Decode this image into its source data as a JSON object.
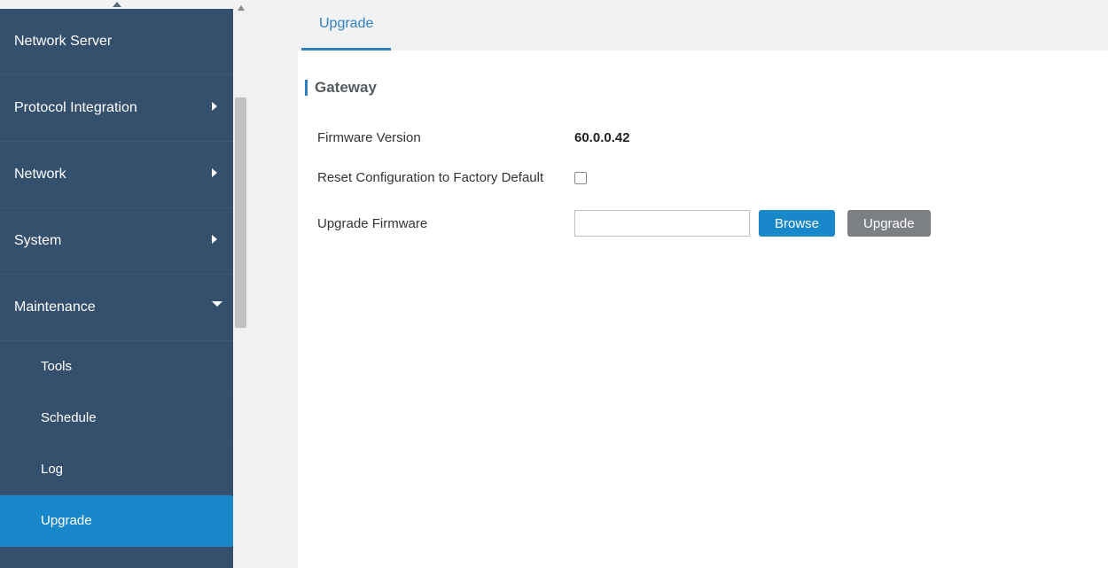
{
  "sidebar": {
    "items": [
      {
        "label": "Network Server",
        "hasChildren": false
      },
      {
        "label": "Protocol Integration",
        "hasChildren": true
      },
      {
        "label": "Network",
        "hasChildren": true
      },
      {
        "label": "System",
        "hasChildren": true
      },
      {
        "label": "Maintenance",
        "hasChildren": true,
        "expanded": true
      }
    ],
    "subitems": [
      {
        "label": "Tools"
      },
      {
        "label": "Schedule"
      },
      {
        "label": "Log"
      },
      {
        "label": "Upgrade"
      }
    ]
  },
  "tabs": {
    "active": "Upgrade"
  },
  "section": {
    "title": "Gateway"
  },
  "form": {
    "firmwareVersionLabel": "Firmware Version",
    "firmwareVersionValue": "60.0.0.42",
    "resetLabel": "Reset Configuration to Factory Default",
    "upgradeFirmwareLabel": "Upgrade Firmware",
    "fileValue": "",
    "browseLabel": "Browse",
    "upgradeLabel": "Upgrade"
  }
}
